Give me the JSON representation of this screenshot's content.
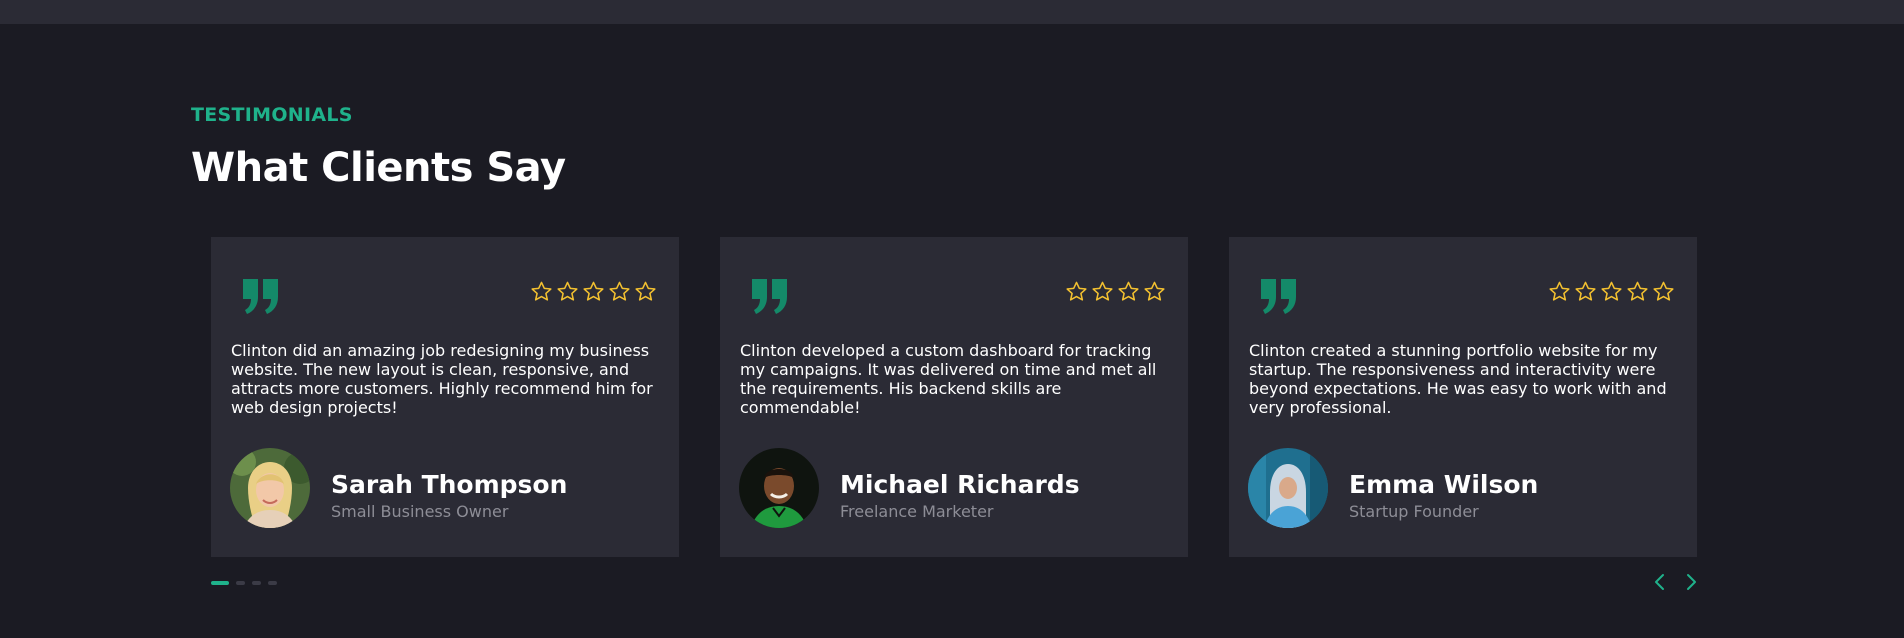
{
  "section": {
    "eyebrow": "TESTIMONIALS",
    "title": "What Clients Say"
  },
  "colors": {
    "accent": "#1fb28b",
    "star": "#f3c130",
    "card_bg": "#2b2b35",
    "page_bg": "#1b1b23"
  },
  "testimonials": [
    {
      "text": "Clinton did an amazing job redesigning my business website. The new layout is clean, responsive, and attracts more customers. Highly recommend him for web design projects!",
      "name": "Sarah Thompson",
      "role": "Small Business Owner",
      "rating": 5,
      "avatar": "woman-blonde-avatar"
    },
    {
      "text": "Clinton developed a custom dashboard for tracking my campaigns. It was delivered on time and met all the requirements. His backend skills are commendable!",
      "name": "Michael Richards",
      "role": "Freelance Marketer",
      "rating": 4,
      "avatar": "man-green-shirt-avatar"
    },
    {
      "text": "Clinton created a stunning portfolio website for my startup. The responsiveness and interactivity were beyond expectations. He was easy to work with and very professional.",
      "name": "Emma Wilson",
      "role": "Startup Founder",
      "rating": 5,
      "avatar": "woman-hooded-avatar"
    }
  ],
  "pagination": {
    "pages": 4,
    "active": 1
  },
  "icons": {
    "quote": "quote-icon",
    "star": "star-outline-icon",
    "prev": "chevron-left-icon",
    "next": "chevron-right-icon"
  }
}
